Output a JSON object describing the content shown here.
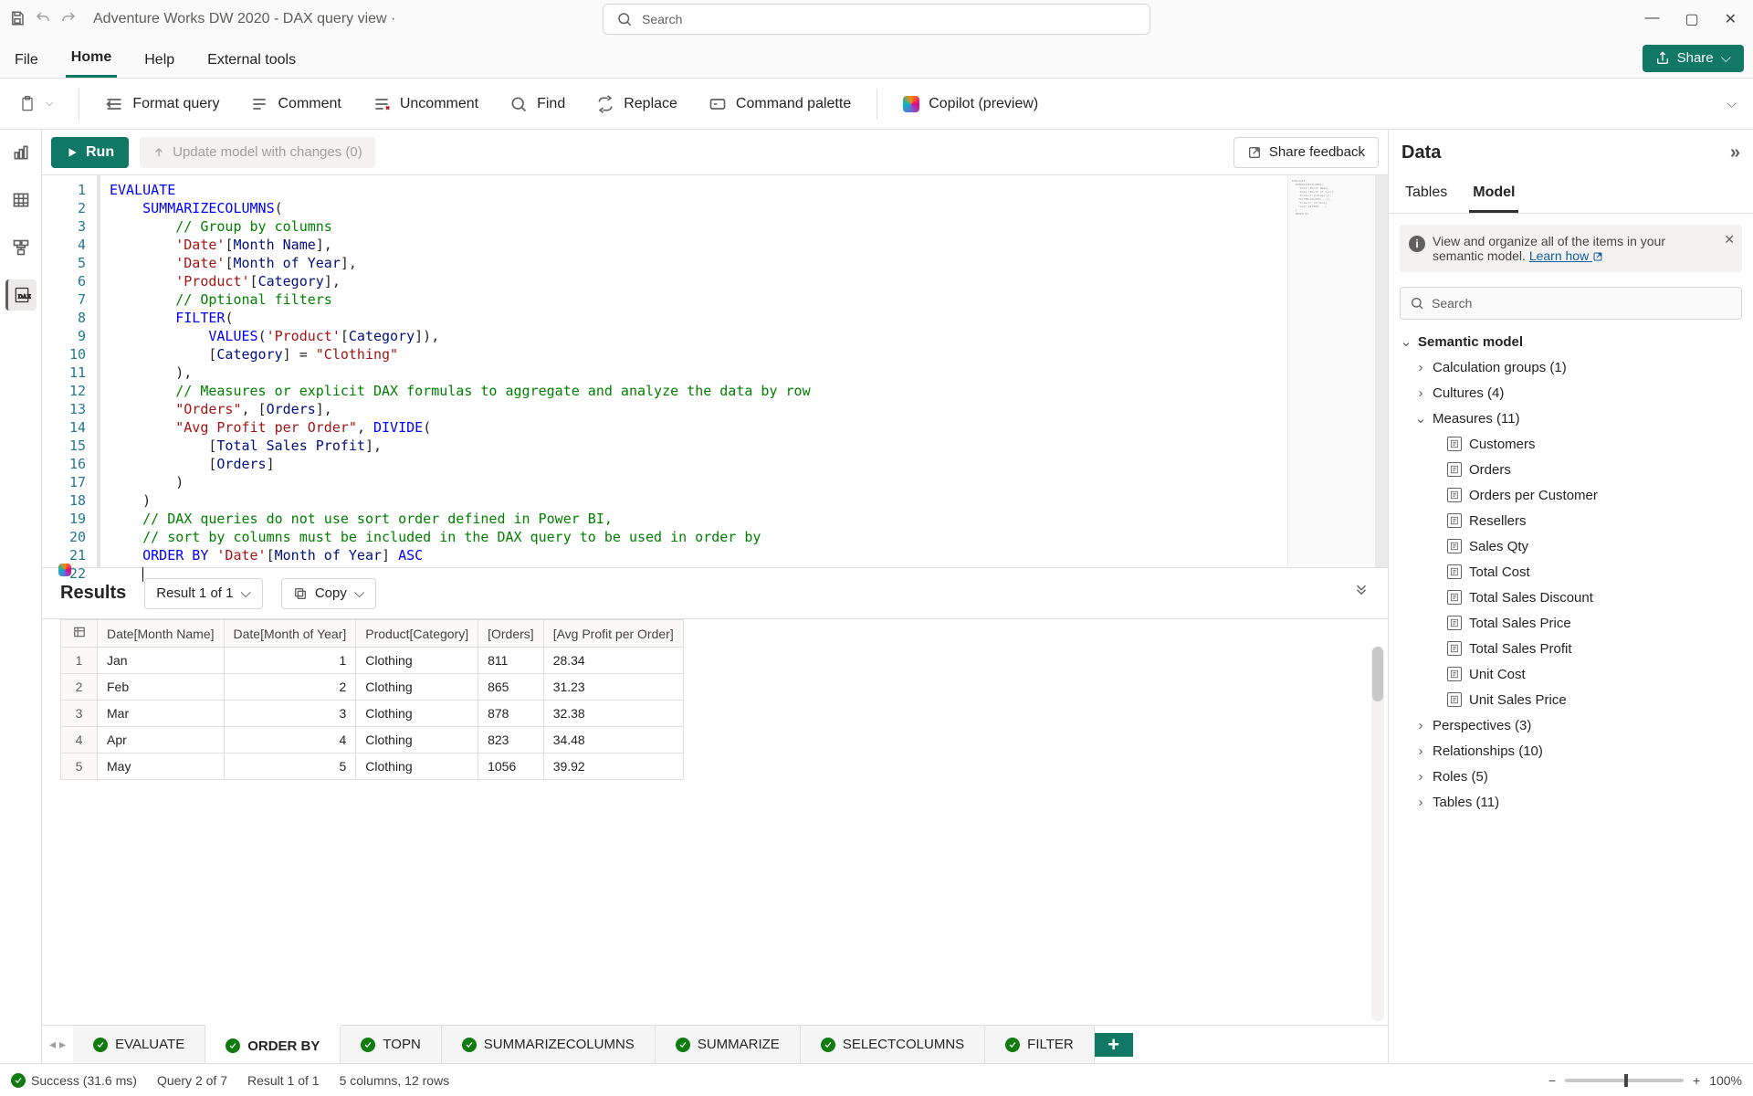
{
  "titlebar": {
    "title": "Adventure Works DW 2020 - DAX query view ·"
  },
  "search": {
    "placeholder": "Search"
  },
  "tabs": {
    "file": "File",
    "home": "Home",
    "help": "Help",
    "external": "External tools",
    "share": "Share"
  },
  "ribbon": {
    "paste": "Paste",
    "format": "Format query",
    "comment": "Comment",
    "uncomment": "Uncomment",
    "find": "Find",
    "replace": "Replace",
    "palette": "Command palette",
    "copilot": "Copilot (preview)"
  },
  "runbar": {
    "run": "Run",
    "update": "Update model with changes (0)",
    "feedback": "Share feedback"
  },
  "dax_lines": [
    {
      "n": 1,
      "html": "<span class='tok-kw'>EVALUATE</span>"
    },
    {
      "n": 2,
      "html": "    <span class='tok-kw'>SUMMARIZECOLUMNS</span>("
    },
    {
      "n": 3,
      "html": "        <span class='tok-com'>// Group by columns</span>"
    },
    {
      "n": 4,
      "html": "        <span class='tok-str'>'Date'</span>[<span class='tok-col'>Month Name</span>],"
    },
    {
      "n": 5,
      "html": "        <span class='tok-str'>'Date'</span>[<span class='tok-col'>Month of Year</span>],"
    },
    {
      "n": 6,
      "html": "        <span class='tok-str'>'Product'</span>[<span class='tok-col'>Category</span>],"
    },
    {
      "n": 7,
      "html": "        <span class='tok-com'>// Optional filters</span>"
    },
    {
      "n": 8,
      "html": "        <span class='tok-kw'>FILTER</span>("
    },
    {
      "n": 9,
      "html": "            <span class='tok-kw'>VALUES</span>(<span class='tok-str'>'Product'</span>[<span class='tok-col'>Category</span>]),"
    },
    {
      "n": 10,
      "html": "            [<span class='tok-col'>Category</span>] = <span class='tok-str'>\"Clothing\"</span>"
    },
    {
      "n": 11,
      "html": "        ),"
    },
    {
      "n": 12,
      "html": "        <span class='tok-com'>// Measures or explicit DAX formulas to aggregate and analyze the data by row</span>"
    },
    {
      "n": 13,
      "html": "        <span class='tok-str'>\"Orders\"</span>, [<span class='tok-col'>Orders</span>],"
    },
    {
      "n": 14,
      "html": "        <span class='tok-str'>\"Avg Profit per Order\"</span>, <span class='tok-kw'>DIVIDE</span>("
    },
    {
      "n": 15,
      "html": "            [<span class='tok-col'>Total Sales Profit</span>],"
    },
    {
      "n": 16,
      "html": "            [<span class='tok-col'>Orders</span>]"
    },
    {
      "n": 17,
      "html": "        )"
    },
    {
      "n": 18,
      "html": "    )"
    },
    {
      "n": 19,
      "html": "    <span class='tok-com'>// DAX queries do not use sort order defined in Power BI,</span>"
    },
    {
      "n": 20,
      "html": "    <span class='tok-com'>// sort by columns must be included in the DAX query to be used in order by</span>"
    },
    {
      "n": 21,
      "html": "    <span class='tok-kw'>ORDER BY</span> <span class='tok-str'>'Date'</span>[<span class='tok-col'>Month of Year</span>] <span class='tok-kw'>ASC</span>"
    },
    {
      "n": 22,
      "html": "    <span class='cursor-caret'></span>"
    }
  ],
  "results": {
    "title": "Results",
    "result_dd": "Result 1 of 1",
    "copy": "Copy",
    "columns": [
      "",
      "Date[Month Name]",
      "Date[Month of Year]",
      "Product[Category]",
      "[Orders]",
      "[Avg Profit per Order]"
    ],
    "rows": [
      {
        "n": 1,
        "month": "Jan",
        "moy": "1",
        "cat": "Clothing",
        "orders": "811",
        "avg": "28.34"
      },
      {
        "n": 2,
        "month": "Feb",
        "moy": "2",
        "cat": "Clothing",
        "orders": "865",
        "avg": "31.23"
      },
      {
        "n": 3,
        "month": "Mar",
        "moy": "3",
        "cat": "Clothing",
        "orders": "878",
        "avg": "32.38"
      },
      {
        "n": 4,
        "month": "Apr",
        "moy": "4",
        "cat": "Clothing",
        "orders": "823",
        "avg": "34.48"
      },
      {
        "n": 5,
        "month": "May",
        "moy": "5",
        "cat": "Clothing",
        "orders": "1056",
        "avg": "39.92"
      }
    ]
  },
  "querytabs": [
    "EVALUATE",
    "ORDER BY",
    "TOPN",
    "SUMMARIZECOLUMNS",
    "SUMMARIZE",
    "SELECTCOLUMNS",
    "FILTER"
  ],
  "querytabs_active_index": 1,
  "datapanel": {
    "title": "Data",
    "tabs": {
      "tables": "Tables",
      "model": "Model"
    },
    "info": "View and organize all of the items in your semantic model. ",
    "info_link": "Learn how",
    "search": "Search",
    "tree": {
      "root": "Semantic model",
      "calc_groups": "Calculation groups (1)",
      "cultures": "Cultures (4)",
      "measures": "Measures (11)",
      "measures_items": [
        "Customers",
        "Orders",
        "Orders per Customer",
        "Resellers",
        "Sales Qty",
        "Total Cost",
        "Total Sales Discount",
        "Total Sales Price",
        "Total Sales Profit",
        "Unit Cost",
        "Unit Sales Price"
      ],
      "perspectives": "Perspectives (3)",
      "relationships": "Relationships (10)",
      "roles": "Roles (5)",
      "tables": "Tables (11)"
    }
  },
  "statusbar": {
    "success": "Success (31.6 ms)",
    "query": "Query 2 of 7",
    "result": "Result 1 of 1",
    "shape": "5 columns, 12 rows",
    "zoom": "100%"
  }
}
